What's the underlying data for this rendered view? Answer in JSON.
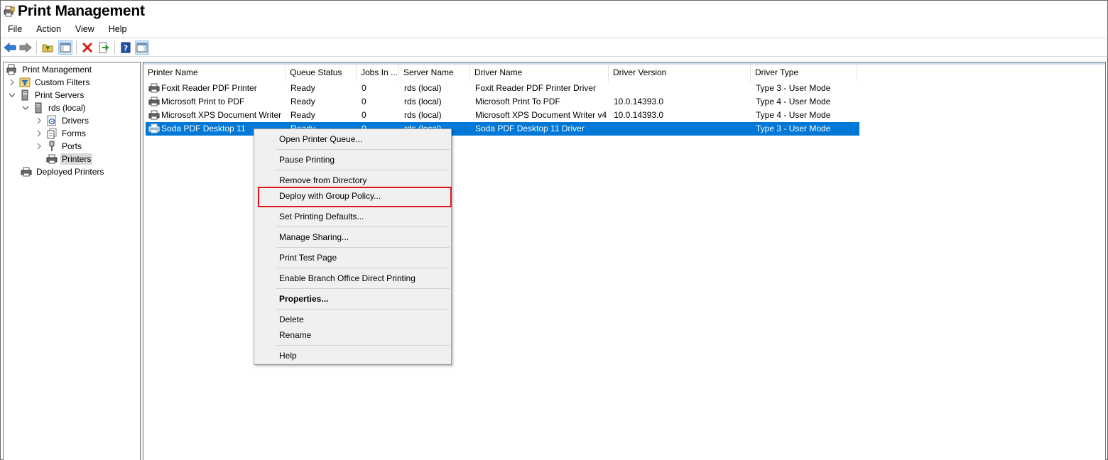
{
  "window": {
    "title": "Print Management"
  },
  "menubar": {
    "items": [
      "File",
      "Action",
      "View",
      "Help"
    ]
  },
  "toolbar": {
    "buttons": [
      "back-icon",
      "forward-icon",
      "up-folder-icon",
      "show-hide-tree-icon",
      "delete-icon",
      "export-icon",
      "help-icon",
      "action-pane-icon"
    ]
  },
  "tree": {
    "root": "Print Management",
    "custom_filters": "Custom Filters",
    "print_servers": "Print Servers",
    "server": "rds (local)",
    "drivers": "Drivers",
    "forms": "Forms",
    "ports": "Ports",
    "printers": "Printers",
    "deployed_printers": "Deployed Printers"
  },
  "table": {
    "columns": [
      "Printer Name",
      "Queue Status",
      "Jobs In ...",
      "Server Name",
      "Driver Name",
      "Driver Version",
      "Driver Type"
    ],
    "rows": [
      {
        "name": "Foxit Reader PDF Printer",
        "status": "Ready",
        "jobs": "0",
        "server": "rds (local)",
        "driver": "Foxit Reader PDF Printer Driver",
        "version": "",
        "type": "Type 3 - User Mode"
      },
      {
        "name": "Microsoft Print to PDF",
        "status": "Ready",
        "jobs": "0",
        "server": "rds (local)",
        "driver": "Microsoft Print To PDF",
        "version": "10.0.14393.0",
        "type": "Type 4 - User Mode"
      },
      {
        "name": "Microsoft XPS Document Writer",
        "status": "Ready",
        "jobs": "0",
        "server": "rds (local)",
        "driver": "Microsoft XPS Document Writer v4",
        "version": "10.0.14393.0",
        "type": "Type 4 - User Mode"
      },
      {
        "name": "Soda PDF Desktop 11",
        "status": "Ready",
        "jobs": "0",
        "server": "rds (local)",
        "driver": "Soda PDF Desktop 11 Driver",
        "version": "",
        "type": "Type 3 - User Mode"
      }
    ],
    "selected_index": 3
  },
  "context_menu": {
    "items": [
      "Open Printer Queue...",
      "Pause Printing",
      "Remove from Directory",
      "Deploy with Group Policy...",
      "Set Printing Defaults...",
      "Manage Sharing...",
      "Print Test Page",
      "Enable Branch Office Direct Printing",
      "Properties...",
      "Delete",
      "Rename",
      "Help"
    ],
    "highlighted": "Deploy with Group Policy...",
    "highlight_color": "#e0141a"
  },
  "colors": {
    "selection": "#0078d7",
    "accent": "#0078d7"
  }
}
